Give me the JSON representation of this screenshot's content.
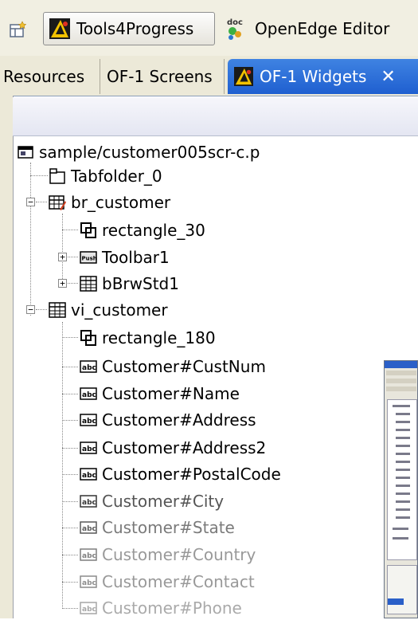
{
  "perspectives": {
    "tools4progress_label": "Tools4Progress",
    "openedge_label": "OpenEdge Editor"
  },
  "tabs": [
    {
      "label": "Resources"
    },
    {
      "label": "OF-1 Screens"
    },
    {
      "label": "OF-1 Widgets",
      "close": "✕"
    }
  ],
  "tree": {
    "root": "sample/customer005scr-c.p",
    "items": [
      {
        "label": "Tabfolder_0",
        "icon": "tabfolder-icon"
      },
      {
        "label": "br_customer",
        "icon": "browse-frame-icon",
        "expander": "−"
      },
      {
        "label": "rectangle_30",
        "icon": "rectangle-icon"
      },
      {
        "label": "Toolbar1",
        "icon": "push-button-icon",
        "expander": "+"
      },
      {
        "label": "bBrwStd1",
        "icon": "browse-icon",
        "expander": "+"
      },
      {
        "label": "vi_customer",
        "icon": "browse-icon",
        "expander": "−"
      },
      {
        "label": "rectangle_180",
        "icon": "rectangle-icon"
      },
      {
        "label": "Customer#CustNum",
        "icon": "fill-in-icon"
      },
      {
        "label": "Customer#Name",
        "icon": "fill-in-icon"
      },
      {
        "label": "Customer#Address",
        "icon": "fill-in-icon"
      },
      {
        "label": "Customer#Address2",
        "icon": "fill-in-icon"
      },
      {
        "label": "Customer#PostalCode",
        "icon": "fill-in-icon"
      },
      {
        "label": "Customer#City",
        "icon": "fill-in-icon"
      },
      {
        "label": "Customer#State",
        "icon": "fill-in-icon"
      },
      {
        "label": "Customer#Country",
        "icon": "fill-in-icon"
      },
      {
        "label": "Customer#Contact",
        "icon": "fill-in-icon"
      },
      {
        "label": "Customer#Phone",
        "icon": "fill-in-icon"
      }
    ]
  },
  "icon_text": {
    "push": "Push",
    "abc": "abc",
    "doc": "doc"
  },
  "colors": {
    "active_tab": "#1f5fd0",
    "chrome": "#ece9d8"
  }
}
